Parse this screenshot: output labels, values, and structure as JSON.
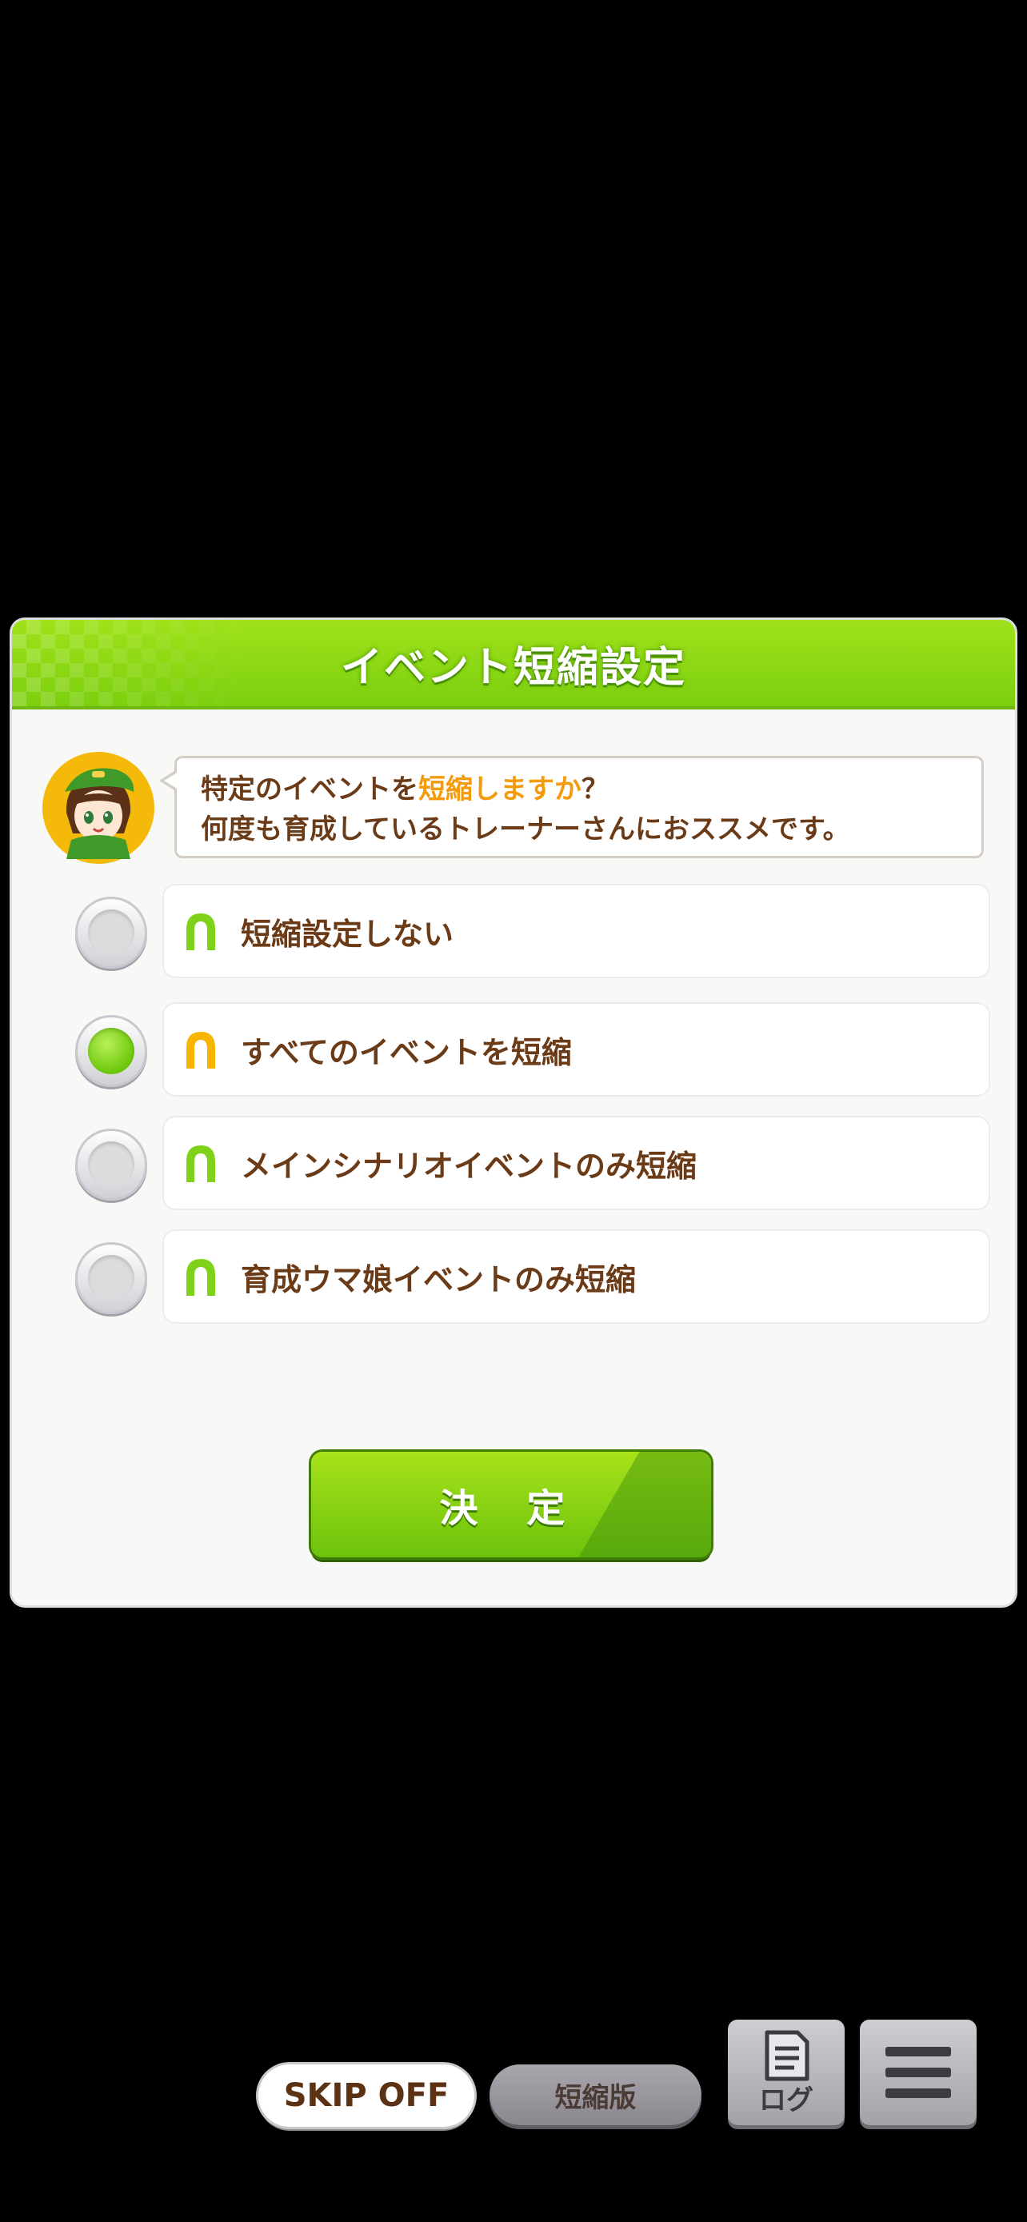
{
  "dialog": {
    "title": "イベント短縮設定",
    "message_line1_before": "特定のイベントを",
    "message_line1_highlight": "短縮しますか",
    "message_line1_after": "？",
    "message_line2": "何度も育成しているトレーナーさんにおススメです。",
    "options": [
      {
        "label": "短縮設定しない",
        "selected": false,
        "icon": "horseshoe-green-icon"
      },
      {
        "label": "すべてのイベントを短縮",
        "selected": true,
        "icon": "horseshoe-gold-icon"
      },
      {
        "label": "メインシナリオイベントのみ短縮",
        "selected": false,
        "icon": "horseshoe-green-icon"
      },
      {
        "label": "育成ウマ娘イベントのみ短縮",
        "selected": false,
        "icon": "horseshoe-green-icon"
      }
    ],
    "confirm_label": "決 定"
  },
  "bottom_bar": {
    "skip_label": "SKIP OFF",
    "short_label": "短縮版",
    "log_label": "ログ"
  },
  "colors": {
    "header_green": "#8bd613",
    "text_brown": "#6b3a17",
    "highlight_orange": "#f59a0b",
    "selected_green": "#6cc70a"
  }
}
